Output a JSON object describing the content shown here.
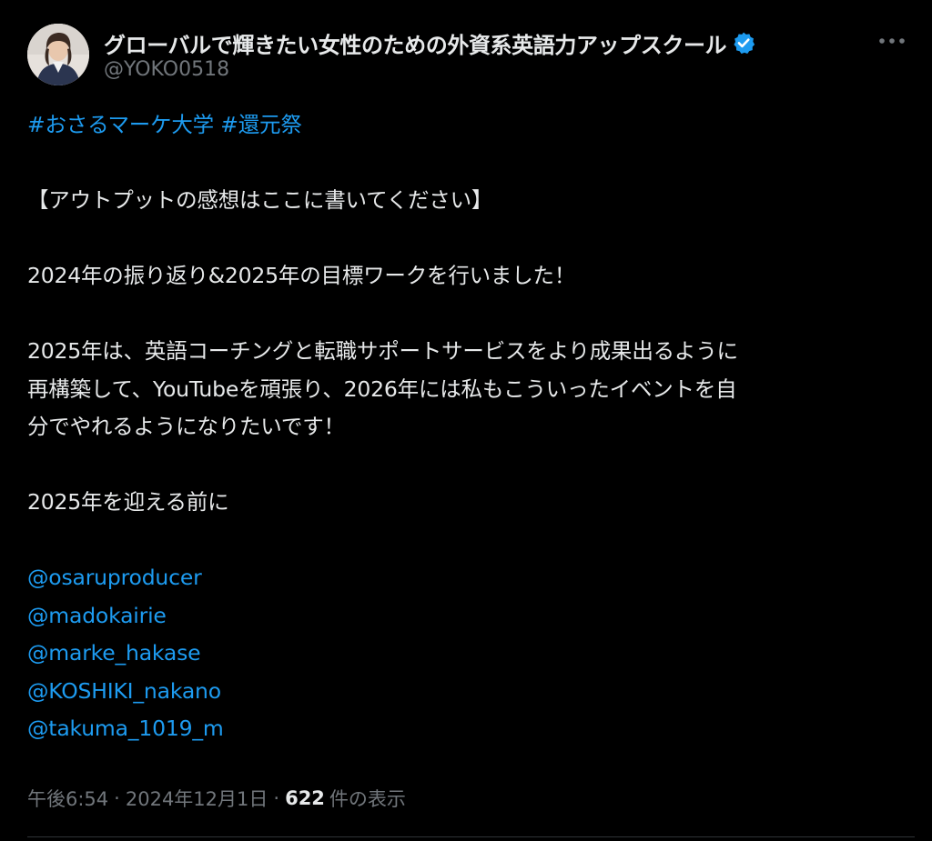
{
  "author": {
    "display_name": "グローバルで輝きたい女性のための外資系英語力アップスクール",
    "handle": "@YOKO0518",
    "verified_icon": "verified-badge-icon",
    "avatar_icon": "profile-photo"
  },
  "post": {
    "hashtags": [
      "#おさるマーケ大学",
      "#還元祭"
    ],
    "heading": "【アウトプットの感想はここに書いてください】",
    "line1": "2024年の振り返り&2025年の目標ワークを行いました！",
    "para2": [
      "2025年は、英語コーチングと転職サポートサービスをより成果出るように",
      "再構築して、YouTubeを頑張り、2026年には私もこういったイベントを自",
      "分でやれるようになりたいです！"
    ],
    "line3": "2025年を迎える前に",
    "mentions": [
      "@osaruproducer",
      "@madokairie",
      "@marke_hakase",
      "@KOSHIKI_nakano",
      "@takuma_1019_m"
    ]
  },
  "meta": {
    "time": "午後6:54",
    "separator": "·",
    "date": "2024年12月1日",
    "views_count": "622",
    "views_label": "件の表示"
  },
  "colors": {
    "background": "#000000",
    "text": "#e7e9ea",
    "muted": "#71767b",
    "link": "#1d9bf0",
    "verified": "#1d9bf0"
  }
}
